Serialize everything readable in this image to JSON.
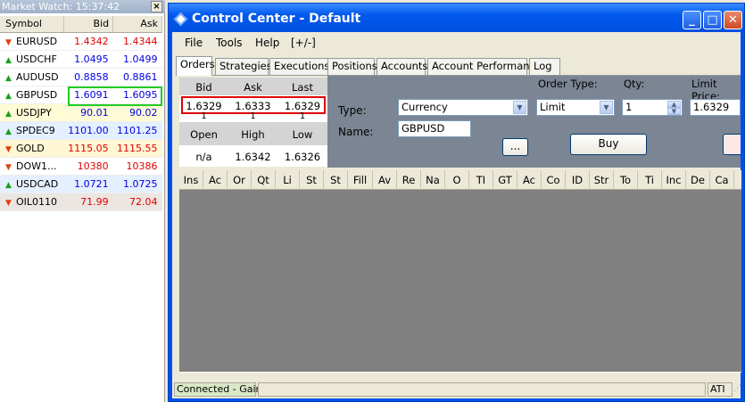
{
  "market_watch": {
    "title": "Market Watch: 15:37:42",
    "columns": [
      "Symbol",
      "Bid",
      "Ask"
    ],
    "rows": [
      {
        "symbol": "EURUSD",
        "bid": "1.4342",
        "ask": "1.4344",
        "dir": "down",
        "color": "#e00000",
        "bg": "#ffffff"
      },
      {
        "symbol": "USDCHF",
        "bid": "1.0495",
        "ask": "1.0499",
        "dir": "up",
        "color": "#0000e0",
        "bg": "#ffffff"
      },
      {
        "symbol": "AUDUSD",
        "bid": "0.8858",
        "ask": "0.8861",
        "dir": "up",
        "color": "#0000e0",
        "bg": "#ffffff"
      },
      {
        "symbol": "GBPUSD",
        "bid": "1.6091",
        "ask": "1.6095",
        "dir": "up",
        "color": "#0000e0",
        "bg": "#ffffff"
      },
      {
        "symbol": "USDJPY",
        "bid": "90.01",
        "ask": "90.02",
        "dir": "up",
        "color": "#0000e0",
        "bg": "#fffbd6"
      },
      {
        "symbol": "SPDEC9",
        "bid": "1101.00",
        "ask": "1101.25",
        "dir": "up",
        "color": "#0000e0",
        "bg": "#e4f0ff"
      },
      {
        "symbol": "GOLD",
        "bid": "1115.05",
        "ask": "1115.55",
        "dir": "down",
        "color": "#e00000",
        "bg": "#fff6d4"
      },
      {
        "symbol": "DOW1...",
        "bid": "10380",
        "ask": "10386",
        "dir": "down",
        "color": "#e00000",
        "bg": "#ffffff"
      },
      {
        "symbol": "USDCAD",
        "bid": "1.0721",
        "ask": "1.0725",
        "dir": "up",
        "color": "#0000e0",
        "bg": "#e4f0ff"
      },
      {
        "symbol": "OIL0110",
        "bid": "71.99",
        "ask": "72.04",
        "dir": "down",
        "color": "#e00000",
        "bg": "#ece6e2"
      }
    ],
    "highlight_row": 3,
    "highlight_color": "#22cc22"
  },
  "control_center": {
    "title": "Control Center - Default",
    "menu": [
      "File",
      "Tools",
      "Help",
      "[+/-]"
    ],
    "tabs": [
      "Orders",
      "Strategies",
      "Executions",
      "Positions",
      "Accounts",
      "Account Performance",
      "Log"
    ],
    "active_tab": 0,
    "quote": {
      "headers": [
        "Bid",
        "Ask",
        "Last"
      ],
      "values": [
        "1.6329",
        "1.6333",
        "1.6329"
      ],
      "sizes": [
        "1",
        "1",
        "1"
      ],
      "headers2": [
        "Open",
        "High",
        "Low"
      ],
      "values2": [
        "n/a",
        "1.6342",
        "1.6326"
      ]
    },
    "order": {
      "type_label": "Type:",
      "type_value": "Currency",
      "name_label": "Name:",
      "name_value": "GBPUSD",
      "order_type_label": "Order Type:",
      "order_type_value": "Limit",
      "qty_label": "Qty:",
      "qty_value": "1",
      "limit_price_label": "Limit Price:",
      "limit_price_value": "1.6329",
      "ellipsis_label": "...",
      "buy_label": "Buy"
    },
    "grid_columns": [
      "Ins",
      "Ac",
      "Or",
      "Qt",
      "Li",
      "St",
      "St",
      "Fill",
      "Av",
      "Re",
      "Na",
      "O",
      "TI",
      "GT",
      "Ac",
      "Co",
      "ID",
      "Str",
      "To",
      "Ti",
      "Inc",
      "De",
      "Ca"
    ],
    "status": {
      "connection": "Connected - Gain",
      "right": "ATI"
    }
  }
}
